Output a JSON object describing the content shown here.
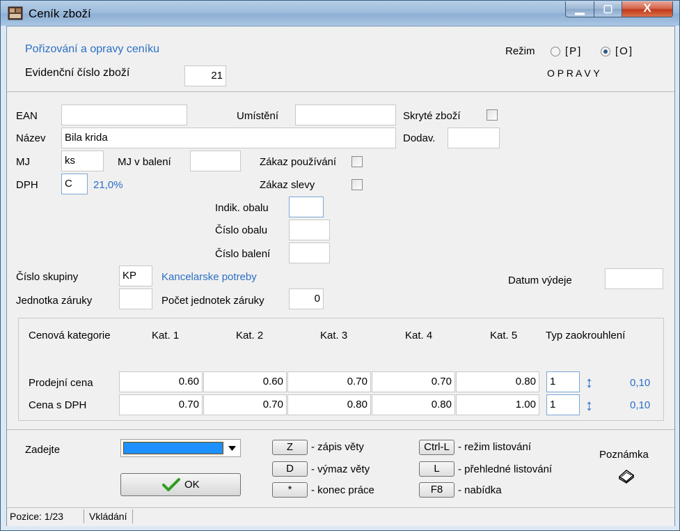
{
  "window": {
    "title": "Ceník zboží",
    "min_glyph": "▁",
    "max_glyph": "▢",
    "close_glyph": "X"
  },
  "header": {
    "heading": "Pořizování a opravy ceníku",
    "evid_label": "Evidenční číslo zboží",
    "evid_value": "21",
    "mode_label": "Režim",
    "mode_p": "[P]",
    "mode_o": "[O]",
    "mode_selected": "O",
    "mode_caption": "O P R A V Y"
  },
  "form": {
    "ean_label": "EAN",
    "ean_value": "",
    "umisteni_label": "Umístění",
    "umisteni_value": "",
    "skryte_label": "Skryté zboží",
    "nazev_label": "Název",
    "nazev_value": "Bila krida",
    "dodav_label": "Dodav.",
    "dodav_value": "",
    "mj_label": "MJ",
    "mj_value": "ks",
    "mjbal_label": "MJ v balení",
    "mjbal_value": "",
    "zakaz_pouz_label": "Zákaz používání",
    "dph_label": "DPH",
    "dph_value": "C",
    "dph_rate": "21,0%",
    "zakaz_slevy_label": "Zákaz slevy",
    "indik_obalu_label": "Indik. obalu",
    "indik_obalu_value": "",
    "cislo_obalu_label": "Číslo obalu",
    "cislo_obalu_value": "",
    "cislo_baleni_label": "Číslo balení",
    "cislo_baleni_value": "",
    "skupina_label": "Číslo skupiny",
    "skupina_value": "KP",
    "skupina_name": "Kancelarske potreby",
    "datum_label": "Datum výdeje",
    "datum_value": "",
    "jedn_zaruky_label": "Jednotka záruky",
    "jedn_zaruky_value": "",
    "pocet_jedn_label": "Počet jednotek záruky",
    "pocet_jedn_value": "0"
  },
  "prices": {
    "header_label": "Cenová kategorie",
    "categories": [
      "Kat. 1",
      "Kat. 2",
      "Kat. 3",
      "Kat. 4",
      "Kat. 5"
    ],
    "rounding_label": "Typ zaokrouhlení",
    "rows": [
      {
        "label": "Prodejní cena",
        "values": [
          "0.60",
          "0.60",
          "0.70",
          "0.70",
          "0.80"
        ],
        "round_type": "1",
        "round_value": "0,10"
      },
      {
        "label": "Cena s DPH",
        "values": [
          "0.70",
          "0.70",
          "0.80",
          "0.80",
          "1.00"
        ],
        "round_type": "1",
        "round_value": "0,10"
      }
    ],
    "updown_glyph": "↕"
  },
  "bottom": {
    "zadejte_label": "Zadejte",
    "ok_label": "OK",
    "keys": [
      {
        "key": "Z",
        "text": "- zápis věty"
      },
      {
        "key": "D",
        "text": "- výmaz věty"
      },
      {
        "key": "*",
        "text": "- konec práce"
      },
      {
        "key": "Ctrl-L",
        "text": "- režim listování"
      },
      {
        "key": "L",
        "text": "- přehledné listování"
      },
      {
        "key": "F8",
        "text": "- nabídka"
      }
    ],
    "note_label": "Poznámka"
  },
  "status": {
    "position": "Pozice: 1/23",
    "mode": "Vkládání"
  },
  "colors": {
    "accent_blue": "#2b6fc4",
    "dropdown_fill": "#1e90ff",
    "ok_check": "#2e9e1f"
  }
}
